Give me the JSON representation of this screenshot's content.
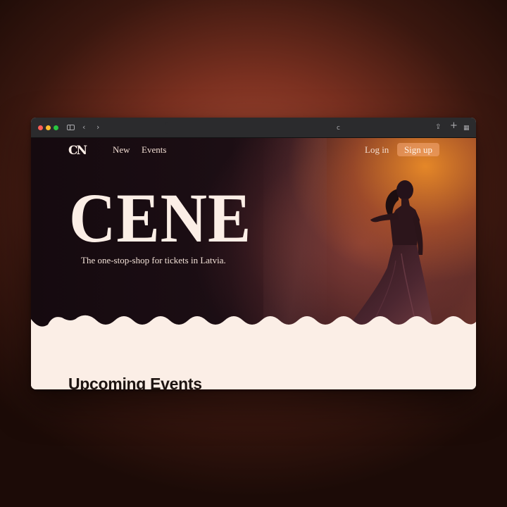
{
  "browser": {
    "icons": [
      "sidebar-icon",
      "back-icon",
      "forward-icon",
      "reload-icon",
      "share-icon",
      "new-tab-icon",
      "tab-overview-icon"
    ],
    "glyphs": {
      "back": "‹",
      "forward": "›",
      "reload": "c",
      "share": "⇪",
      "new_tab": "+",
      "tabs": "▦"
    }
  },
  "nav": {
    "logo": "CN",
    "links": [
      "New",
      "Events"
    ],
    "login": "Log in",
    "signup": "Sign up"
  },
  "hero": {
    "title": "CENE",
    "tagline": "The one-stop-shop for tickets in Latvia."
  },
  "sections": {
    "upcoming_title": "Upcoming Events"
  },
  "colors": {
    "page_bg": "#fbeee6",
    "hero_dark": "#150a0f",
    "accent_orange": "#ec8c28",
    "signup_bg": "#f6aa78"
  }
}
